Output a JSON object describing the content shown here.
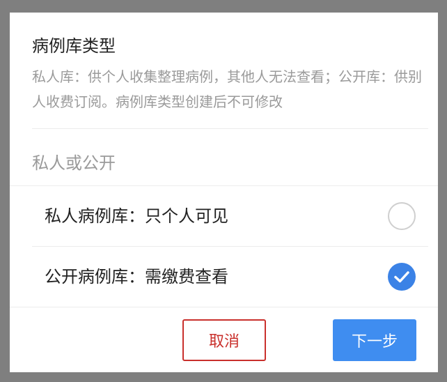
{
  "dialog": {
    "title": "病例库类型",
    "description": "私人库：供个人收集整理病例，其他人无法查看；公开库：供别人收费订阅。病例库类型创建后不可修改",
    "section_label": "私人或公开",
    "options": [
      {
        "label": "私人病例库：只个人可见",
        "selected": false
      },
      {
        "label": "公开病例库：需缴费查看",
        "selected": true
      }
    ],
    "buttons": {
      "cancel": "取消",
      "next": "下一步"
    }
  },
  "colors": {
    "overlay": "#7f7f7f",
    "accent": "#3b82e6",
    "cancel": "#c9302c"
  },
  "icons": {
    "selected": "checkmark-icon"
  }
}
